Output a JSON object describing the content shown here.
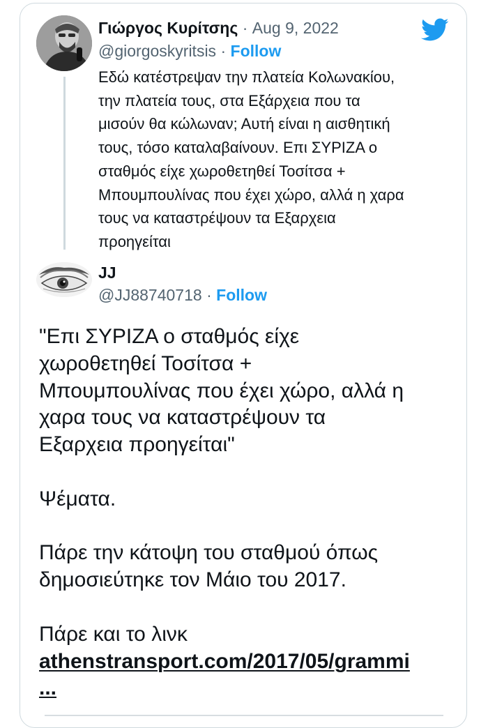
{
  "quoted_tweet": {
    "author_name": "Γιώργος Κυρίτσης",
    "separator": "·",
    "date": "Aug 9, 2022",
    "handle": "@giorgoskyritsis",
    "follow_label": "Follow",
    "text_lines": [
      "Εδώ κατέστρεψαν την πλατεία Κολωνακίου,",
      "την πλατεία τους, στα Εξάρχεια που τα",
      "μισούν θα κώλωναν; Αυτή είναι η αισθητική",
      "τους, τόσο καταλαβαίνουν. Επι ΣΥΡΙΖΑ ο",
      "σταθμός είχε χωροθετηθεί Τοσίτσα +",
      "Μπουμπουλίνας που έχει χώρο, αλλά η χαρα",
      "τους να καταστρέψουν τα Εξαρχεια",
      "προηγείται"
    ]
  },
  "reply_tweet": {
    "author_name": "JJ",
    "handle": "@JJ88740718",
    "separator": "·",
    "follow_label": "Follow",
    "quote_lines": [
      "\"Επι ΣΥΡΙΖΑ ο σταθμός είχε",
      "χωροθετηθεί Τοσίτσα +",
      "Μπουμπουλίνας που έχει χώρο, αλλά η",
      "χαρα τους να καταστρέψουν τα",
      "Εξαρχεια προηγείται\""
    ],
    "lie_text": "Ψέματα.",
    "plan_lines": [
      "Πάρε την κάτοψη του σταθμού όπως",
      "δημοσιεύτηκε τον Μάιο του 2017."
    ],
    "link_intro": "Πάρε και το λινκ",
    "link_text": "athenstransport.com/2017/05/grammi",
    "link_ellipsis": "..."
  },
  "icons": {
    "brand": "twitter-bird-icon",
    "brand_color": "#1d9bf0"
  },
  "colors": {
    "text": "#0f1419",
    "muted": "#536471",
    "accent": "#1d9bf0",
    "border": "#cfd9de"
  }
}
